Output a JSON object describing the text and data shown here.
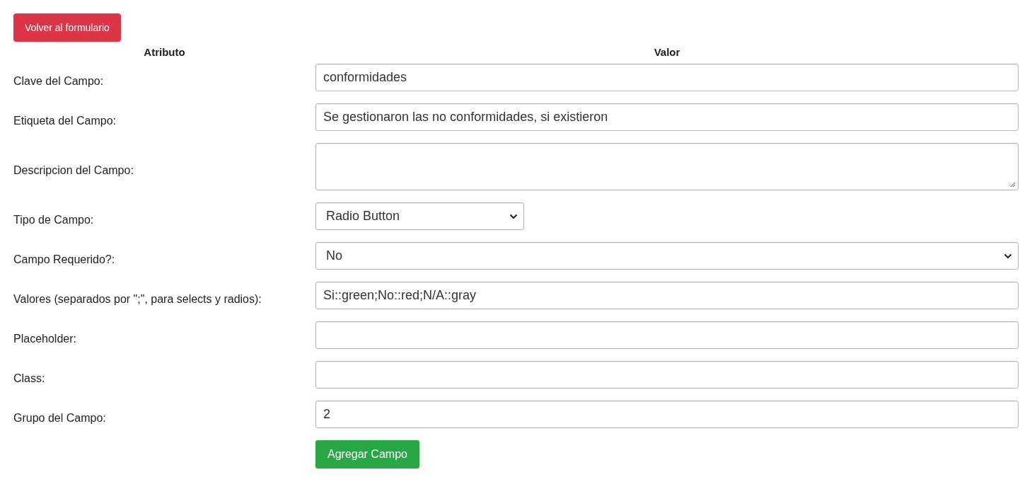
{
  "back_button": "Volver al formulario",
  "table": {
    "columns": [
      "Atributo",
      "Valor"
    ],
    "rows": [
      {
        "label": "Clave del Campo:",
        "kind": "text",
        "value": "conformidades"
      },
      {
        "label": "Etiqueta del Campo:",
        "kind": "text",
        "value": "Se gestionaron las no conformidades, si existieron"
      },
      {
        "label": "Descripcion del Campo:",
        "kind": "textarea"
      },
      {
        "label": "Tipo de Campo:",
        "kind": "select",
        "compact": true,
        "value": "Radio Button"
      },
      {
        "label": "Campo Requerido?:",
        "kind": "select",
        "compact": false,
        "value": "No"
      },
      {
        "label": "Valores (separados por \";\", para selects y radios):",
        "kind": "text",
        "value": "Si::green;No::red;N/A::gray"
      },
      {
        "label": "Placeholder:",
        "kind": "text"
      },
      {
        "label": "Class:",
        "kind": "text"
      },
      {
        "label": "Grupo del Campo:",
        "kind": "text",
        "value": "2"
      }
    ]
  },
  "submit_button": "Agregar Campo"
}
